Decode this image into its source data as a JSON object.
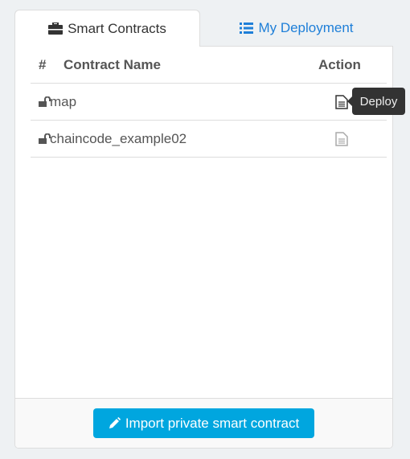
{
  "tabs": [
    {
      "label": "Smart Contracts",
      "icon": "briefcase-icon",
      "active": true
    },
    {
      "label": "My Deployment",
      "icon": "list-icon",
      "active": false
    }
  ],
  "table": {
    "headers": [
      "#",
      "Contract Name",
      "Action"
    ],
    "rows": [
      {
        "name": "map",
        "icon": "unlock-icon",
        "action": "file-text-icon"
      },
      {
        "name": "chaincode_example02",
        "icon": "unlock-icon",
        "action": "file-text-icon"
      }
    ]
  },
  "tooltip": "Deploy",
  "footer": {
    "button_label": "Import private smart contract",
    "button_icon": "pencil-icon"
  },
  "colors": {
    "accent": "#00a6df",
    "link": "#1e7fd8"
  }
}
